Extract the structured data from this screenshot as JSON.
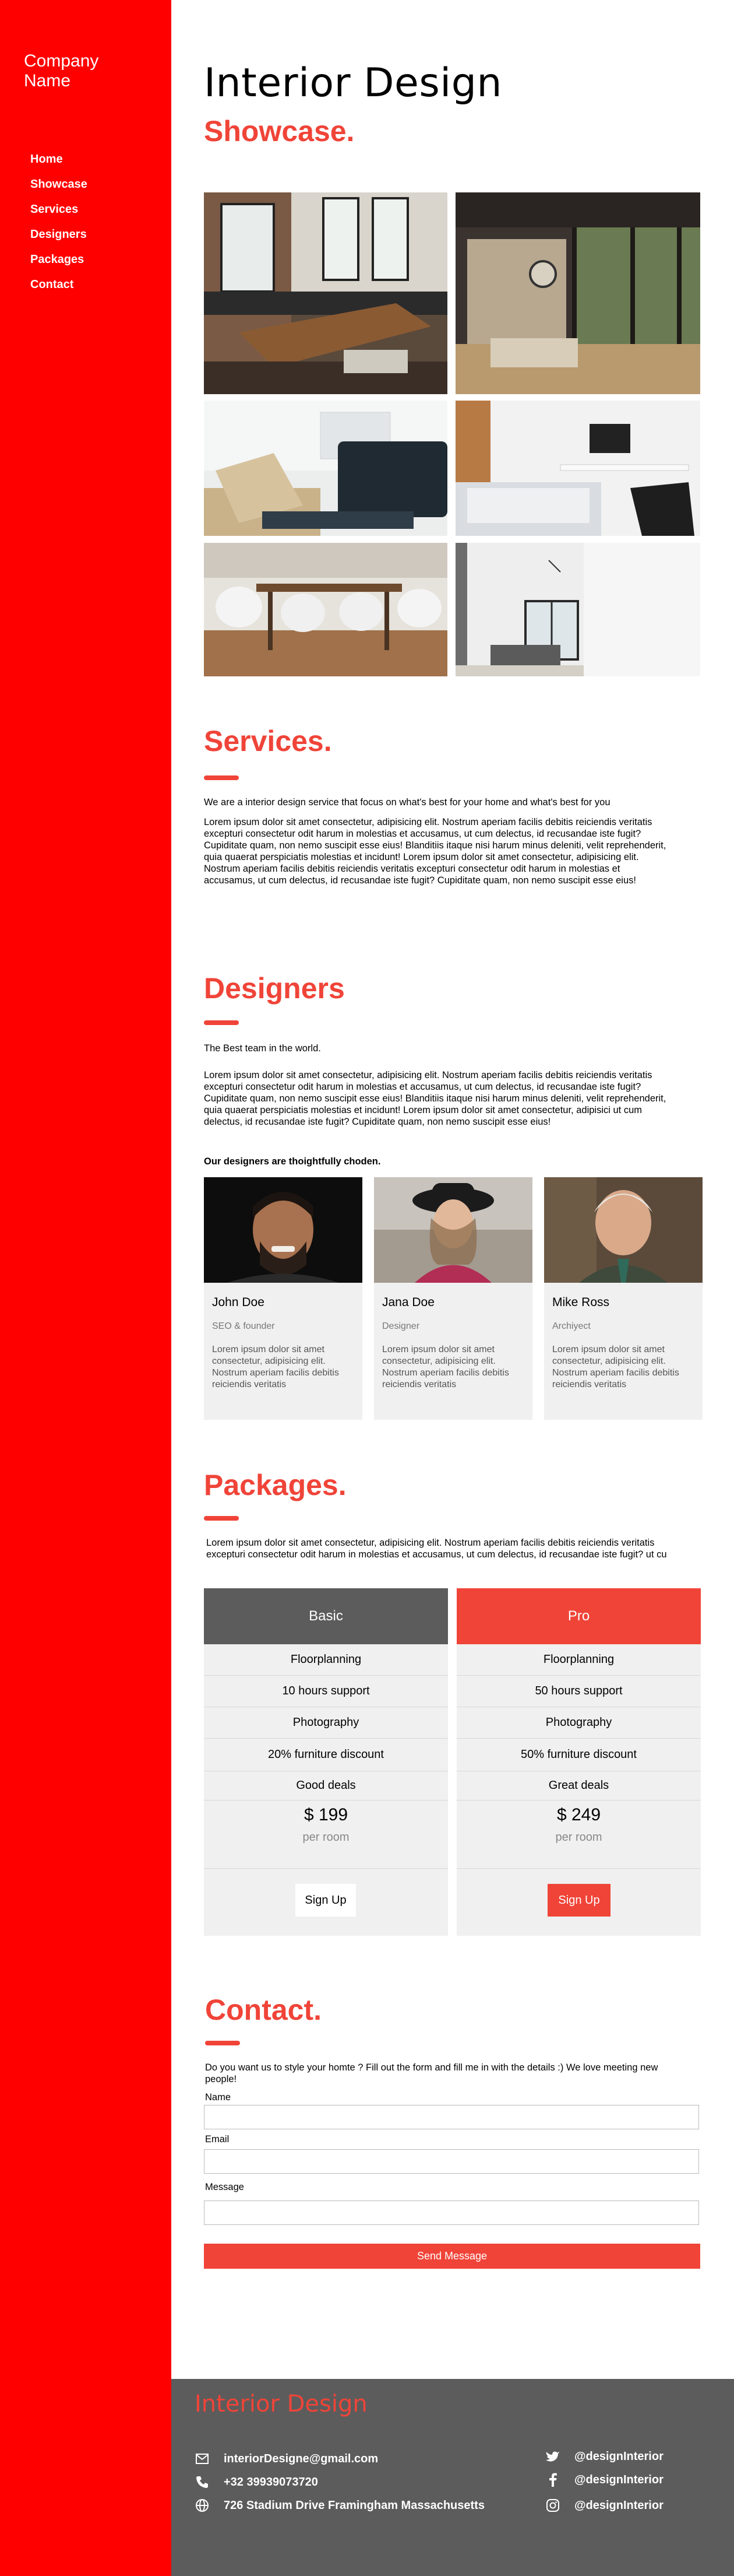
{
  "sidebar": {
    "company": "Company Name",
    "nav": [
      "Home",
      "Showcase",
      "Services",
      "Designers",
      "Packages",
      "Contact"
    ]
  },
  "header": {
    "title": "Interior Design",
    "subtitle": "Showcase."
  },
  "services": {
    "title": "Services.",
    "intro": "We are a interior design service that focus on what's best for your home and what's best for you",
    "body": "Lorem ipsum dolor sit amet consectetur, adipisicing elit. Nostrum aperiam facilis debitis reiciendis veritatis excepturi consectetur odit harum in molestias et accusamus, ut cum delectus, id recusandae iste fugit? Cupiditate quam, non nemo suscipit esse eius! Blanditiis itaque nisi harum minus deleniti, velit reprehenderit, quia quaerat perspiciatis molestias et incidunt!  Lorem ipsum dolor sit amet consectetur, adipisicing elit. Nostrum aperiam facilis debitis reiciendis veritatis excepturi consectetur odit harum in molestias et accusamus, ut cum delectus, id recusandae iste fugit? Cupiditate quam, non nemo suscipit esse eius!"
  },
  "designers": {
    "title": "Designers",
    "tagline": "The Best team in the world.",
    "body": "Lorem ipsum dolor sit amet consectetur, adipisicing elit. Nostrum aperiam facilis debitis reiciendis veritatis excepturi consectetur odit harum in molestias et accusamus, ut cum delectus, id recusandae iste fugit? Cupiditate quam, non nemo suscipit esse eius! Blanditiis itaque nisi harum minus deleniti, velit reprehenderit, quia quaerat perspiciatis molestias et incidunt!  Lorem ipsum dolor sit amet consectetur, adipisici ut cum delectus, id recusandae iste fugit? Cupiditate quam, non nemo suscipit esse eius!",
    "chosen": "Our designers are thoightfully choden.",
    "cards": [
      {
        "name": "John Doe",
        "role": "SEO & founder",
        "desc": "Lorem ipsum dolor sit amet consectetur, adipisicing elit. Nostrum aperiam facilis debitis reiciendis veritatis"
      },
      {
        "name": "Jana Doe",
        "role": "Designer",
        "desc": "Lorem ipsum dolor sit amet consectetur, adipisicing elit. Nostrum aperiam facilis debitis reiciendis veritatis"
      },
      {
        "name": "Mike Ross",
        "role": "Archiyect",
        "desc": "Lorem ipsum dolor sit amet consectetur, adipisicing elit. Nostrum aperiam facilis debitis reiciendis veritatis"
      }
    ]
  },
  "packages": {
    "title": "Packages.",
    "intro": "Lorem ipsum dolor sit amet consectetur, adipisicing elit. Nostrum aperiam facilis debitis reiciendis veritatis excepturi consectetur odit harum in molestias et accusamus, ut cum delectus, id recusandae iste fugit?  ut cu",
    "plans": [
      {
        "name": "Basic",
        "features": [
          "Floorplanning",
          "10 hours support",
          "Photography",
          "20% furniture discount",
          "Good deals"
        ],
        "price": "$ 199",
        "per": "per room",
        "cta": "Sign Up",
        "header_color": "#5c5c5c"
      },
      {
        "name": "Pro",
        "features": [
          "Floorplanning",
          "50 hours support",
          "Photography",
          "50% furniture discount",
          "Great deals"
        ],
        "price": "$ 249",
        "per": "per room",
        "cta": "Sign Up",
        "header_color": "#f04438"
      }
    ]
  },
  "contact": {
    "title": "Contact.",
    "intro": "Do you want us to style your homte ? Fill out the form and fill me in with the details :) We love meeting new people!",
    "name_label": "Name",
    "email_label": "Email",
    "message_label": "Message",
    "name_value": "",
    "email_value": "",
    "message_value": "",
    "send": "Send Message"
  },
  "footer": {
    "title": "Interior Design",
    "email": "interiorDesigne@gmail.com",
    "phone": "+32 39939073720",
    "address": "726 Stadium Drive Framingham Massachusetts",
    "twitter": "@designInterior",
    "facebook": "@designInterior",
    "instagram": "@designInterior"
  },
  "colors": {
    "sidebar": "#ff0000",
    "accent": "#f04438",
    "footer": "#5c5c5c",
    "card_bg": "#f0f0f0"
  }
}
